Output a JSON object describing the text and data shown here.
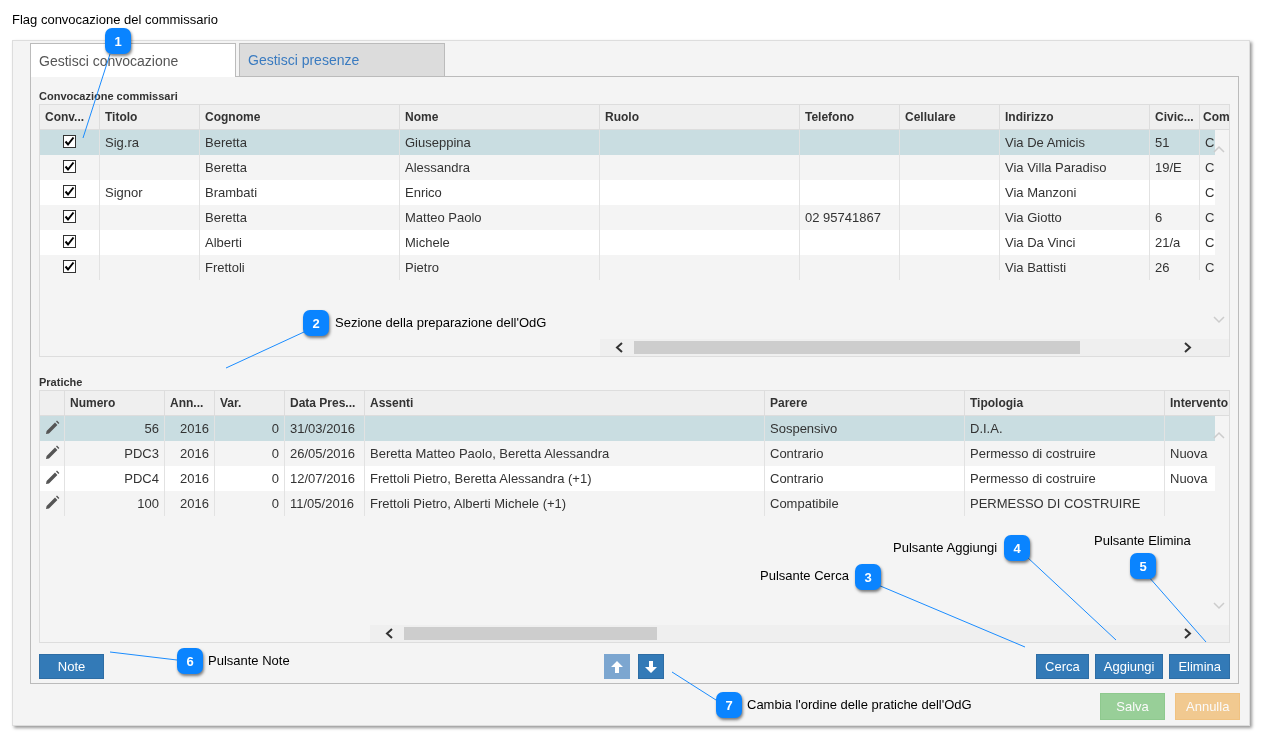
{
  "page_title": "Flag convocazione del commissario",
  "tabs": [
    {
      "label": "Gestisci convocazione",
      "selected": true
    },
    {
      "label": "Gestisci presenze",
      "selected": false
    }
  ],
  "commissari": {
    "title": "Convocazione commissari",
    "columns": [
      "Conv...",
      "Titolo",
      "Cognome",
      "Nome",
      "Ruolo",
      "Telefono",
      "Cellulare",
      "Indirizzo",
      "Civic...",
      "Com"
    ],
    "rows": [
      {
        "selected": true,
        "checked": true,
        "cells": [
          "",
          "Sig.ra",
          "Beretta",
          "Giuseppina",
          "",
          "",
          "",
          "Via De Amicis",
          "51",
          "C"
        ]
      },
      {
        "selected": false,
        "checked": true,
        "cells": [
          "",
          "",
          "Beretta",
          "Alessandra",
          "",
          "",
          "",
          "Via Villa Paradiso",
          "19/E",
          "C"
        ]
      },
      {
        "selected": false,
        "checked": true,
        "cells": [
          "",
          "Signor",
          "Brambati",
          "Enrico",
          "",
          "",
          "",
          "Via Manzoni",
          "",
          "C"
        ]
      },
      {
        "selected": false,
        "checked": true,
        "cells": [
          "",
          "",
          "Beretta",
          "Matteo Paolo",
          "",
          "02 95741867",
          "",
          "Via Giotto",
          "6",
          "C"
        ]
      },
      {
        "selected": false,
        "checked": true,
        "cells": [
          "",
          "",
          "Alberti",
          "Michele",
          "",
          "",
          "",
          "Via Da Vinci",
          "21/a",
          "C"
        ]
      },
      {
        "selected": false,
        "checked": true,
        "cells": [
          "",
          "",
          "Frettoli",
          "Pietro",
          "",
          "",
          "",
          "Via Battisti",
          "26",
          "C"
        ]
      }
    ]
  },
  "pratiche": {
    "title": "Pratiche",
    "columns": [
      "Numero",
      "Ann...",
      "Var.",
      "Data Pres...",
      "Assenti",
      "Parere",
      "Tipologia",
      "Intervento"
    ],
    "rows": [
      {
        "selected": true,
        "cells": [
          "56",
          "2016",
          "0",
          "31/03/2016",
          null,
          "Sospensivo",
          "D.I.A.",
          null
        ]
      },
      {
        "selected": false,
        "cells": [
          "PDC3",
          "2016",
          "0",
          "26/05/2016",
          "Beretta Matteo Paolo, Beretta Alessandra",
          "Contrario",
          "Permesso di costruire",
          "Nuova"
        ]
      },
      {
        "selected": false,
        "cells": [
          "PDC4",
          "2016",
          "0",
          "12/07/2016",
          "Frettoli Pietro, Beretta Alessandra (+1)",
          "Contrario",
          "Permesso di costruire",
          "Nuova"
        ]
      },
      {
        "selected": false,
        "cells": [
          "100",
          "2016",
          "0",
          "11/05/2016",
          "Frettoli Pietro, Alberti Michele (+1)",
          "Compatibile",
          "PERMESSO DI COSTRUIRE",
          null
        ]
      }
    ]
  },
  "note_button": {
    "label": "Note"
  },
  "order_buttons": [
    {
      "kind": "up",
      "disabled": true
    },
    {
      "kind": "down",
      "disabled": false
    }
  ],
  "action_buttons": [
    {
      "label": "Cerca"
    },
    {
      "label": "Aggiungi"
    },
    {
      "label": "Elimina"
    }
  ],
  "dialog_buttons": [
    {
      "label": "Salva",
      "kind": "save",
      "disabled": true
    },
    {
      "label": "Annulla",
      "kind": "cancel",
      "disabled": true
    }
  ],
  "callouts": [
    {
      "number": "1"
    },
    {
      "number": "2",
      "text": "Sezione della preparazione dell'OdG"
    },
    {
      "number": "3",
      "text": "Pulsante Cerca"
    },
    {
      "number": "4",
      "text": "Pulsante Aggiungi"
    },
    {
      "number": "5",
      "text": "Pulsante Elimina"
    },
    {
      "number": "6",
      "text": "Pulsante Note"
    },
    {
      "number": "7",
      "text": "Cambia l'ordine delle pratiche dell'OdG"
    }
  ]
}
